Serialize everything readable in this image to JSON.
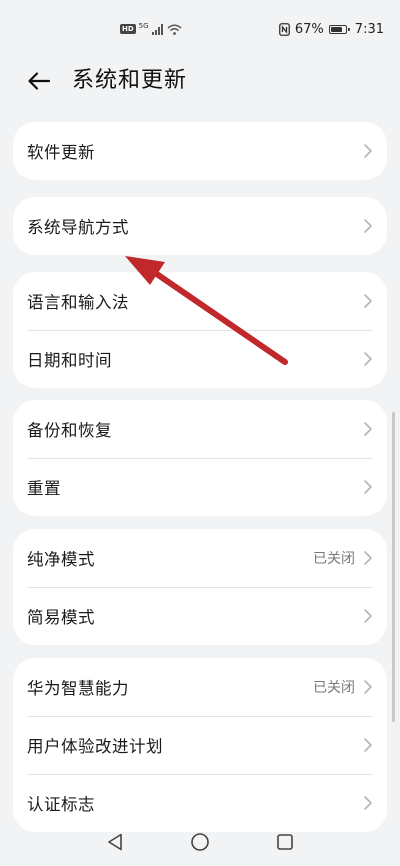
{
  "status_bar": {
    "hd_badge": "HD",
    "network": "5G",
    "battery": "67%",
    "time": "7:31"
  },
  "header": {
    "title": "系统和更新"
  },
  "groups": [
    {
      "items": [
        {
          "label": "软件更新",
          "status": ""
        }
      ]
    },
    {
      "items": [
        {
          "label": "系统导航方式",
          "status": ""
        }
      ]
    },
    {
      "items": [
        {
          "label": "语言和输入法",
          "status": ""
        },
        {
          "label": "日期和时间",
          "status": ""
        }
      ]
    },
    {
      "items": [
        {
          "label": "备份和恢复",
          "status": ""
        },
        {
          "label": "重置",
          "status": ""
        }
      ]
    },
    {
      "items": [
        {
          "label": "纯净模式",
          "status": "已关闭"
        },
        {
          "label": "简易模式",
          "status": ""
        }
      ]
    },
    {
      "items": [
        {
          "label": "华为智慧能力",
          "status": "已关闭"
        },
        {
          "label": "用户体验改进计划",
          "status": ""
        },
        {
          "label": "认证标志",
          "status": ""
        }
      ]
    }
  ],
  "colors": {
    "background": "#f1f3f5",
    "card": "#ffffff",
    "annotation_arrow": "#c0282b"
  }
}
